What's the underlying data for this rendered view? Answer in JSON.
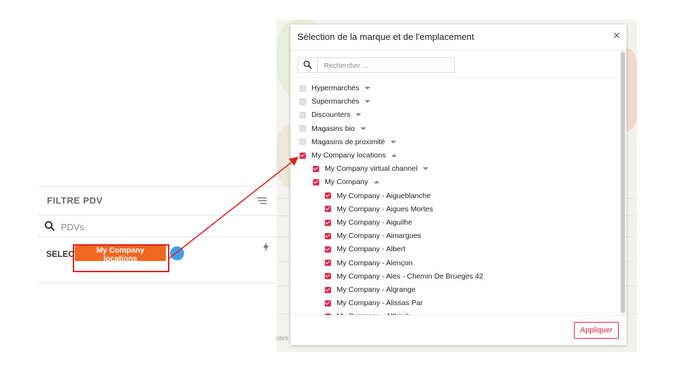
{
  "filter_panel": {
    "title": "FILTRE PDV",
    "search_placeholder": "PDVs",
    "select_label": "SELECT",
    "selected_tag": "My Company locations"
  },
  "modal": {
    "title": "Sélection de la marque et de l'emplacement",
    "close_glyph": "×",
    "search_placeholder": "Rechercher ...",
    "apply_label": "Appliquer",
    "items": [
      {
        "label": "Hypermarchés",
        "checked": false,
        "level": 0,
        "caret": "down"
      },
      {
        "label": "Supermarchés",
        "checked": false,
        "level": 0,
        "caret": "down"
      },
      {
        "label": "Discounters",
        "checked": false,
        "level": 0,
        "caret": "down"
      },
      {
        "label": "Magasins bio",
        "checked": false,
        "level": 0,
        "caret": "down"
      },
      {
        "label": "Magasins de proximité",
        "checked": false,
        "level": 0,
        "caret": "down"
      },
      {
        "label": "My Company locations",
        "checked": true,
        "level": 0,
        "caret": "up"
      },
      {
        "label": "My Company virtual channel",
        "checked": true,
        "level": 1,
        "caret": "down"
      },
      {
        "label": "My Company",
        "checked": true,
        "level": 1,
        "caret": "up"
      },
      {
        "label": "My Company - Aigueblanche",
        "checked": true,
        "level": 2,
        "caret": ""
      },
      {
        "label": "My Company - Aigues Mortes",
        "checked": true,
        "level": 2,
        "caret": ""
      },
      {
        "label": "My Company - Aiguilhe",
        "checked": true,
        "level": 2,
        "caret": ""
      },
      {
        "label": "My Company - Aimargues",
        "checked": true,
        "level": 2,
        "caret": ""
      },
      {
        "label": "My Company - Albert",
        "checked": true,
        "level": 2,
        "caret": ""
      },
      {
        "label": "My Company - Alençon",
        "checked": true,
        "level": 2,
        "caret": ""
      },
      {
        "label": "My Company - Ales - Chemin De Brueges 42",
        "checked": true,
        "level": 2,
        "caret": ""
      },
      {
        "label": "My Company - Algrange",
        "checked": true,
        "level": 2,
        "caret": ""
      },
      {
        "label": "My Company - Alissas Par",
        "checked": true,
        "level": 2,
        "caret": ""
      },
      {
        "label": "My Company - Altkirch",
        "checked": true,
        "level": 2,
        "caret": ""
      }
    ]
  },
  "footer_fragment": "ntes",
  "colors": {
    "accent_orange": "#f26722",
    "checkbox_red": "#e0284a",
    "annotation_red": "#e02020",
    "add_button_blue": "#3fa0e8"
  },
  "icons": {
    "sort": "sort-lines-icon",
    "search": "magnifier-icon",
    "bolt": "lightning-icon",
    "close": "close-icon",
    "caret": "caret-icon",
    "check": "checkbox-check-icon"
  }
}
